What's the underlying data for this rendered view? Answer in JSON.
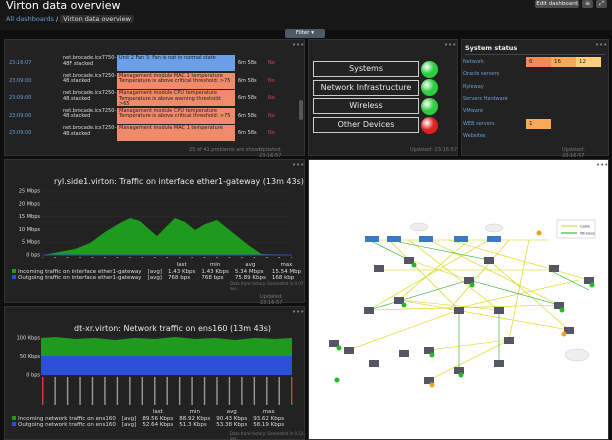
{
  "header": {
    "title": "Virton data overview",
    "breadcrumb": {
      "all": "All dashboards",
      "sep": "/",
      "current": "Virton data overview"
    },
    "edit_label": "Edit dashboard",
    "filter_label": "Filter ▾"
  },
  "problems": {
    "rows": [
      {
        "time": "23:16:07",
        "host": "net.brocade.icx7750-48F stacked",
        "problem": "Unit 2 Fan 3: Fan is not in normal state",
        "duration": "6m 58s",
        "ack": "No",
        "color": "#6b9fe8"
      },
      {
        "time": "23:09:00",
        "host": "net.brocade.icx7250-48.stacked",
        "problem": "Management module MAC 1 temperature Temperature is above critical threshold: >75",
        "duration": "6m 58s",
        "ack": "No",
        "color": "#ef8a6a"
      },
      {
        "time": "23:09:00",
        "host": "net.brocade.icx7250-48.stacked",
        "problem": "Management module CPU temperature Temperature is above warning threshold: >65",
        "duration": "6m 58s",
        "ack": "No",
        "color": "#ef8a6a"
      },
      {
        "time": "23:09:00",
        "host": "net.brocade.icx7250-48.stacked",
        "problem": "Management module CPU temperature Temperature is above critical threshold: >75",
        "duration": "6m 58s",
        "ack": "No",
        "color": "#ef8a6a"
      },
      {
        "time": "23:09:00",
        "host": "net.brocade.icx7250-48.stacked",
        "problem": "Management module MAC 1 temperature",
        "duration": "6m 58s",
        "ack": "No",
        "color": "#ef8a6a"
      }
    ],
    "footer": "25 of 41 problems are shown",
    "updated": "Updated: 23:16:57"
  },
  "map_buttons": {
    "items": [
      {
        "label": "Systems",
        "status": "#2ecc40"
      },
      {
        "label": "Network Infrastructure",
        "status": "#2ecc40"
      },
      {
        "label": "Wireless",
        "status": "#2ecc40"
      },
      {
        "label": "Other Devices",
        "status": "#e02020"
      }
    ],
    "updated": "Updated: 23:16:57"
  },
  "system_status": {
    "title": "System status",
    "rows": [
      {
        "name": "Network",
        "cells": [
          {
            "v": "6",
            "c": "#f48a5a"
          },
          {
            "v": "16",
            "c": "#f9a857"
          },
          {
            "v": "12",
            "c": "#fcd07a"
          }
        ]
      },
      {
        "name": "Oracle servers",
        "cells": []
      },
      {
        "name": "Ryleway",
        "cells": []
      },
      {
        "name": "Servers Hardware",
        "cells": []
      },
      {
        "name": "VMware",
        "cells": []
      },
      {
        "name": "WEB servers",
        "cells": [
          {
            "v": "1",
            "c": "#f9a857"
          }
        ]
      },
      {
        "name": "Websites",
        "cells": []
      }
    ],
    "updated": "Updated: 23:16:57"
  },
  "graph1": {
    "title": "ryl.side1.virton: Traffic on interface ether1-gateway (13m 43s)",
    "yticks": [
      "25 Mbps",
      "20 Mbps",
      "15 Mbps",
      "10 Mbps",
      "5 Mbps",
      "0 bps"
    ],
    "legend_headers": [
      "last",
      "min",
      "avg",
      "max"
    ],
    "legend": [
      {
        "name": "Incoming traffic on interface ether1-gateway",
        "agg": "[avg]",
        "last": "1.43 Kbps",
        "min": "1.43 Kbps",
        "avg": "5.34 Mbps",
        "max": "15.54 Mbp",
        "color": "#1e9a1e"
      },
      {
        "name": "Outgoing traffic on interface ether1-gateway",
        "agg": "[avg]",
        "last": "768 bps",
        "min": "768 bps",
        "avg": "75.89 Kbps",
        "max": "168 kbp",
        "color": "#2a4fd8"
      }
    ],
    "source": "Data from history. Generated in 0.07 sec.",
    "updated": "Updated: 23:16:57"
  },
  "graph2": {
    "title": "dt-xr.virton: Network traffic on ens160 (13m 43s)",
    "yticks": [
      "100 Kbps",
      "50 Kbps",
      "0 bps"
    ],
    "legend_headers": [
      "last",
      "min",
      "avg",
      "max"
    ],
    "legend": [
      {
        "name": "Incoming network traffic on ens160",
        "agg": "[avg]",
        "last": "89.56 Kbps",
        "min": "88.92 Kbps",
        "avg": "90.43 Kbps",
        "max": "93.62 Kbps",
        "color": "#1e9a1e"
      },
      {
        "name": "Outgoing network traffic on ens160",
        "agg": "[avg]",
        "last": "52.64 Kbps",
        "min": "51.3 Kbps",
        "avg": "53.38 Kbps",
        "max": "58.19 Kbps",
        "color": "#2a4fd8"
      }
    ],
    "source": "Data from history. Generated in 0.13 sec."
  },
  "network_map": {
    "legend": [
      "Cable",
      "Wireless"
    ]
  }
}
